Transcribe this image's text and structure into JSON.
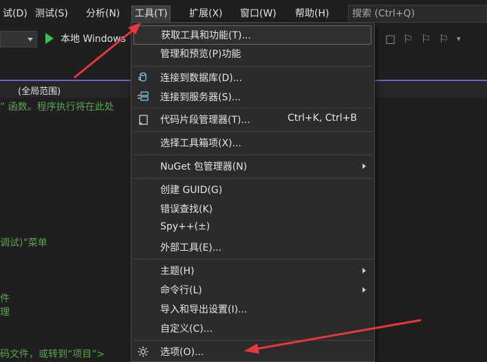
{
  "menubar": {
    "items": [
      {
        "label": "试(D)"
      },
      {
        "label": "测试(S)"
      },
      {
        "label": "分析(N)"
      },
      {
        "label": "工具(T)"
      },
      {
        "label": "扩展(X)"
      },
      {
        "label": "窗口(W)"
      },
      {
        "label": "帮助(H)"
      }
    ],
    "search_placeholder": "搜索 (Ctrl+Q)"
  },
  "toolbar": {
    "run_label": "本地 Windows"
  },
  "scope": {
    "label": "(全局范围)"
  },
  "editor": {
    "lines": [
      "” 函数。程序执行将在此处",
      "调试)”菜单",
      "件",
      "理",
      "码文件，或转到“项目”>"
    ]
  },
  "tools_menu": {
    "items": [
      {
        "label": "获取工具和功能(T)...",
        "shortcut": "",
        "submenu": false
      },
      {
        "label": "管理和预览(P)功能",
        "shortcut": "",
        "submenu": false
      },
      {
        "label": "连接到数据库(D)...",
        "shortcut": "",
        "submenu": false
      },
      {
        "label": "连接到服务器(S)...",
        "shortcut": "",
        "submenu": false
      },
      {
        "label": "代码片段管理器(T)...",
        "shortcut": "Ctrl+K, Ctrl+B",
        "submenu": false
      },
      {
        "label": "选择工具箱项(X)...",
        "shortcut": "",
        "submenu": false
      },
      {
        "label": "NuGet 包管理器(N)",
        "shortcut": "",
        "submenu": true
      },
      {
        "label": "创建 GUID(G)",
        "shortcut": "",
        "submenu": false
      },
      {
        "label": "错误查找(K)",
        "shortcut": "",
        "submenu": false
      },
      {
        "label": "Spy++(±)",
        "shortcut": "",
        "submenu": false
      },
      {
        "label": "外部工具(E)...",
        "shortcut": "",
        "submenu": false
      },
      {
        "label": "主题(H)",
        "shortcut": "",
        "submenu": true
      },
      {
        "label": "命令行(L)",
        "shortcut": "",
        "submenu": true
      },
      {
        "label": "导入和导出设置(I)...",
        "shortcut": "",
        "submenu": false
      },
      {
        "label": "自定义(C)...",
        "shortcut": "",
        "submenu": false
      },
      {
        "label": "选项(O)...",
        "shortcut": "",
        "submenu": false
      }
    ]
  },
  "colors": {
    "annotation_arrow": "#e8383b",
    "accent": "#7a5fc7",
    "run_green": "#3fbf4f"
  }
}
